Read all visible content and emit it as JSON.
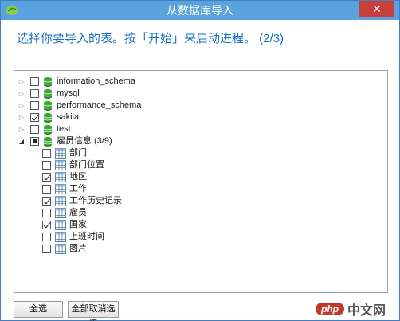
{
  "window": {
    "title": "从数据库导入",
    "close_label": "✕",
    "app_icon": "database-leaf-icon"
  },
  "instruction": "选择你要导入的表。按「开始」来启动进程。 (2/3)",
  "tree": {
    "databases": [
      {
        "name": "information_schema",
        "checked": false,
        "expanded": false
      },
      {
        "name": "mysql",
        "checked": false,
        "expanded": false
      },
      {
        "name": "performance_schema",
        "checked": false,
        "expanded": false
      },
      {
        "name": "sakila",
        "checked": true,
        "expanded": false
      },
      {
        "name": "test",
        "checked": false,
        "expanded": false
      },
      {
        "name": "雇员信息 (3/9)",
        "checked": "partial",
        "expanded": true
      }
    ],
    "tables": [
      {
        "name": "部门",
        "checked": false
      },
      {
        "name": "部门位置",
        "checked": false
      },
      {
        "name": "地区",
        "checked": true
      },
      {
        "name": "工作",
        "checked": false
      },
      {
        "name": "工作历史记录",
        "checked": true
      },
      {
        "name": "雇员",
        "checked": false
      },
      {
        "name": "国家",
        "checked": true
      },
      {
        "name": "上班时间",
        "checked": false
      },
      {
        "name": "图片",
        "checked": false
      }
    ]
  },
  "buttons": {
    "select_all": "全选",
    "deselect_all": "全部取消选择"
  },
  "watermark": {
    "php": "php",
    "cn": "中文网"
  },
  "colors": {
    "titlebar": "#5aa2dd",
    "instruction": "#1a6fc4",
    "db_icon": "#3aa935",
    "close": "#c9403a"
  }
}
